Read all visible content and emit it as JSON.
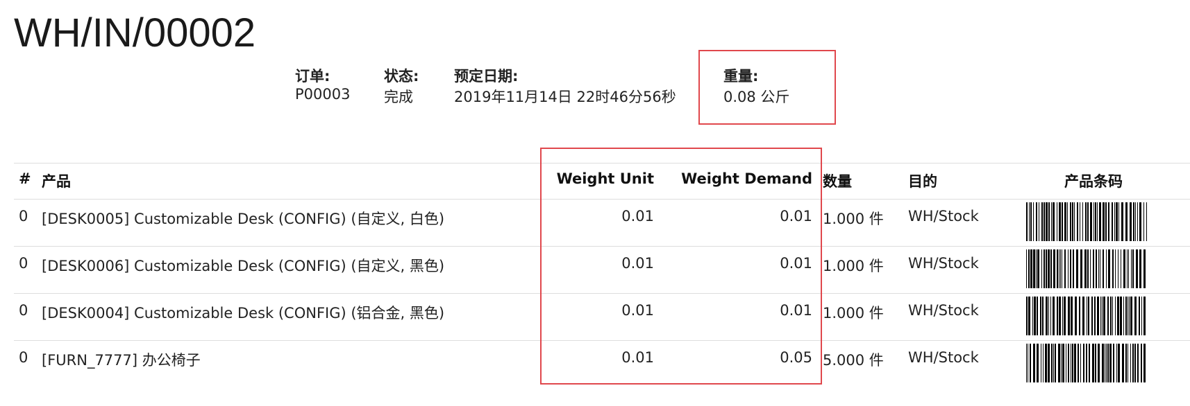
{
  "doc": {
    "title": "WH/IN/00002"
  },
  "info": [
    {
      "label": "订单:",
      "value": "P00003"
    },
    {
      "label": "状态:",
      "value": "完成"
    },
    {
      "label": "预定日期:",
      "value": "2019年11月14日 22时46分56秒"
    },
    {
      "label": "重量:",
      "value": "0.08 公斤"
    }
  ],
  "table": {
    "headers": {
      "num": "#",
      "product": "产品",
      "weight_unit": "Weight Unit",
      "weight_demand": "Weight Demand",
      "qty": "数量",
      "dest": "目的",
      "barcode": "产品条码"
    },
    "rows": [
      {
        "num": "0",
        "product": "[DESK0005] Customizable Desk (CONFIG) (自定义, 白色)",
        "weight_unit": "0.01",
        "weight_demand": "0.01",
        "qty": "1.000 件",
        "dest": "WH/Stock"
      },
      {
        "num": "0",
        "product": "[DESK0006] Customizable Desk (CONFIG) (自定义, 黑色)",
        "weight_unit": "0.01",
        "weight_demand": "0.01",
        "qty": "1.000 件",
        "dest": "WH/Stock"
      },
      {
        "num": "0",
        "product": "[DESK0004] Customizable Desk (CONFIG) (铝合金, 黑色)",
        "weight_unit": "0.01",
        "weight_demand": "0.01",
        "qty": "1.000 件",
        "dest": "WH/Stock"
      },
      {
        "num": "0",
        "product": "[FURN_7777] 办公椅子",
        "weight_unit": "0.01",
        "weight_demand": "0.05",
        "qty": "5.000 件",
        "dest": "WH/Stock"
      }
    ]
  },
  "colors": {
    "highlight": "#e0474c",
    "rule": "#dddddd"
  }
}
